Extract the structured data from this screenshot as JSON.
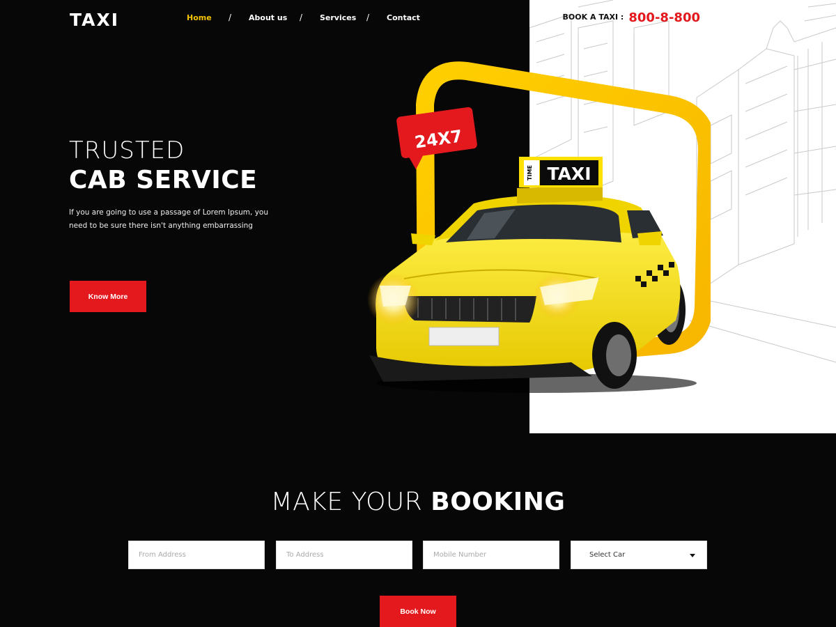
{
  "header": {
    "logo_text": "TAXI",
    "nav": [
      {
        "label": "Home",
        "active": true
      },
      {
        "label": "About us",
        "active": false
      },
      {
        "label": "Services",
        "active": false
      },
      {
        "label": "Contact",
        "active": false
      }
    ],
    "nav_separator": "/",
    "book_label": "BOOK A TAXI :",
    "phone": "800-8-800"
  },
  "hero": {
    "title_line1": "TRUSTED",
    "title_line2": "CAB SERVICE",
    "description": "If you are going to use a passage of Lorem Ipsum, you need to be sure there isn't anything embarrassing",
    "button_label": "Know More",
    "badge_text": "24X7",
    "roof_sign_small": "TIME",
    "roof_sign_large": "TAXI"
  },
  "booking": {
    "title_light": "MAKE YOUR",
    "title_bold": "BOOKING",
    "from_placeholder": "From Address",
    "to_placeholder": "To Address",
    "mobile_placeholder": "Mobile Number",
    "car_select_value": "Select Car",
    "submit_label": "Book Now"
  },
  "colors": {
    "background": "#070707",
    "accent_yellow": "#f5c400",
    "accent_red": "#e3191d",
    "panel_white": "#ffffff"
  }
}
